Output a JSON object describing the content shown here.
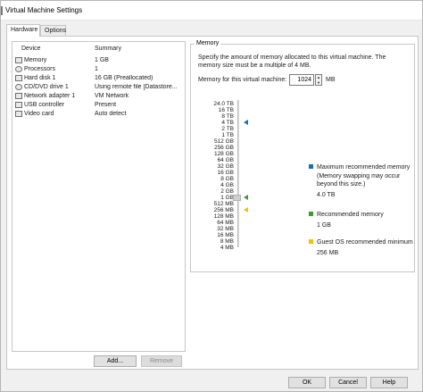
{
  "window": {
    "title": "Virtual Machine Settings"
  },
  "tabs": [
    {
      "label": "Hardware"
    },
    {
      "label": "Options"
    }
  ],
  "device_list": {
    "headers": {
      "device": "Device",
      "summary": "Summary"
    },
    "rows": [
      {
        "device": "Memory",
        "summary": "1 GB",
        "icon": "memory-icon"
      },
      {
        "device": "Processors",
        "summary": "1",
        "icon": "processor-icon"
      },
      {
        "device": "Hard disk 1",
        "summary": "16 GB (Preallocated)",
        "icon": "hard-disk-icon"
      },
      {
        "device": "CD/DVD drive 1",
        "summary": "Using remote file [Datastore...",
        "icon": "cd-dvd-icon"
      },
      {
        "device": "Network adapter 1",
        "summary": "VM Network",
        "icon": "network-adapter-icon"
      },
      {
        "device": "USB controller",
        "summary": "Present",
        "icon": "usb-icon"
      },
      {
        "device": "Video card",
        "summary": "Auto detect",
        "icon": "video-card-icon"
      }
    ],
    "add_label": "Add...",
    "remove_label": "Remove"
  },
  "memory": {
    "group_title": "Memory",
    "description": "Specify the amount of memory allocated to this virtual machine. The memory size must be a multiple of 4 MB.",
    "field_label": "Memory for this virtual machine:",
    "value": "1024",
    "unit": "MB",
    "scale_labels": [
      "24.0 TB",
      "16 TB",
      "8 TB",
      "4 TB",
      "2 TB",
      "1 TB",
      "512 GB",
      "256 GB",
      "128 GB",
      "64 GB",
      "32 GB",
      "16 GB",
      "8 GB",
      "4 GB",
      "2 GB",
      "1 GB",
      "512 MB",
      "256 MB",
      "128 MB",
      "64 MB",
      "32 MB",
      "16 MB",
      "8 MB",
      "4 MB"
    ],
    "legend": {
      "max_title": "Maximum recommended memory",
      "max_note": "(Memory swapping may occur beyond this size.)",
      "max_value": "4.0 TB",
      "rec_title": "Recommended memory",
      "rec_value": "1 GB",
      "guest_title": "Guest OS recommended minimum",
      "guest_value": "256 MB"
    },
    "colors": {
      "max": "#1b6fae",
      "recommended": "#3f9b2a",
      "guest_min": "#f2c200"
    }
  },
  "footer": {
    "ok": "OK",
    "cancel": "Cancel",
    "help": "Help"
  }
}
